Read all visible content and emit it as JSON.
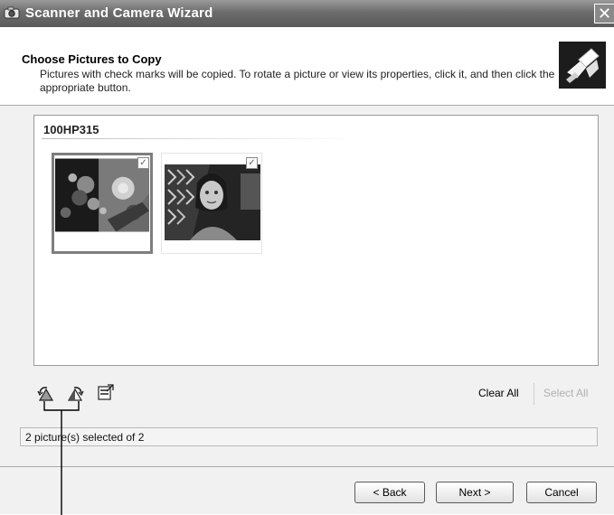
{
  "window": {
    "title": "Scanner and Camera Wizard",
    "close_glyph": "✕"
  },
  "header": {
    "title": "Choose Pictures to Copy",
    "description": "Pictures with check marks will be copied. To rotate a picture or view its properties, click it, and then click the appropriate button."
  },
  "pane": {
    "folder_name": "100HP315",
    "pictures": [
      {
        "checked": true,
        "selected": true
      },
      {
        "checked": true,
        "selected": false
      }
    ]
  },
  "toolbar": {
    "icons": [
      "rotate-left-icon",
      "rotate-right-icon",
      "properties-icon"
    ],
    "clear_all": "Clear All",
    "select_all": "Select All"
  },
  "status": {
    "text": "2 picture(s) selected of 2"
  },
  "buttons": {
    "back": "< Back",
    "next": "Next >",
    "cancel": "Cancel"
  },
  "colors": {
    "titlebar": "#6c6c6c",
    "selected_border": "#7e7e7e",
    "disabled_text": "#b0b0b0"
  }
}
